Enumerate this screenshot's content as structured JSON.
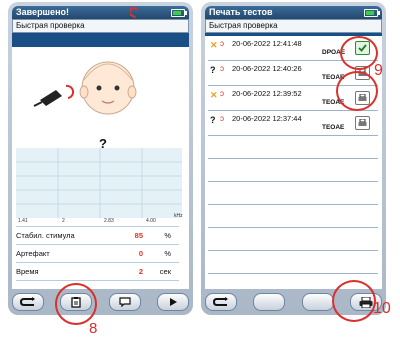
{
  "left": {
    "title": "Завершено!",
    "subtitle": "Быстрая проверка",
    "result_symbol": "?",
    "freq_ticks": [
      "1.41",
      "2",
      "2.83",
      "4.00",
      "kHz"
    ],
    "metrics": [
      {
        "label": "Стабил. стимула",
        "value": "85",
        "unit": "%"
      },
      {
        "label": "Артефакт",
        "value": "0",
        "unit": "%"
      },
      {
        "label": "Время",
        "value": "2",
        "unit": "сек"
      }
    ]
  },
  "right": {
    "title": "Печать тестов",
    "subtitle": "Быстрая проверка",
    "records": [
      {
        "result": "✕",
        "datetime": "20-06-2022  12:41:48",
        "type": "DPOAE",
        "checked": true
      },
      {
        "result": "?",
        "datetime": "20-06-2022  12:40:26",
        "type": "TEOAE",
        "checked": false
      },
      {
        "result": "✕",
        "datetime": "20-06-2022  12:39:52",
        "type": "TEOAE",
        "checked": false
      },
      {
        "result": "?",
        "datetime": "20-06-2022  12:37:44",
        "type": "TEOAE",
        "checked": false
      }
    ]
  },
  "callouts": {
    "print_button_label": "8",
    "record_print_label": "9",
    "print_all_label": "10"
  },
  "colors": {
    "highlight": "#d9312b",
    "header": "#2c5a86",
    "accent_blue": "#1a4e86"
  }
}
